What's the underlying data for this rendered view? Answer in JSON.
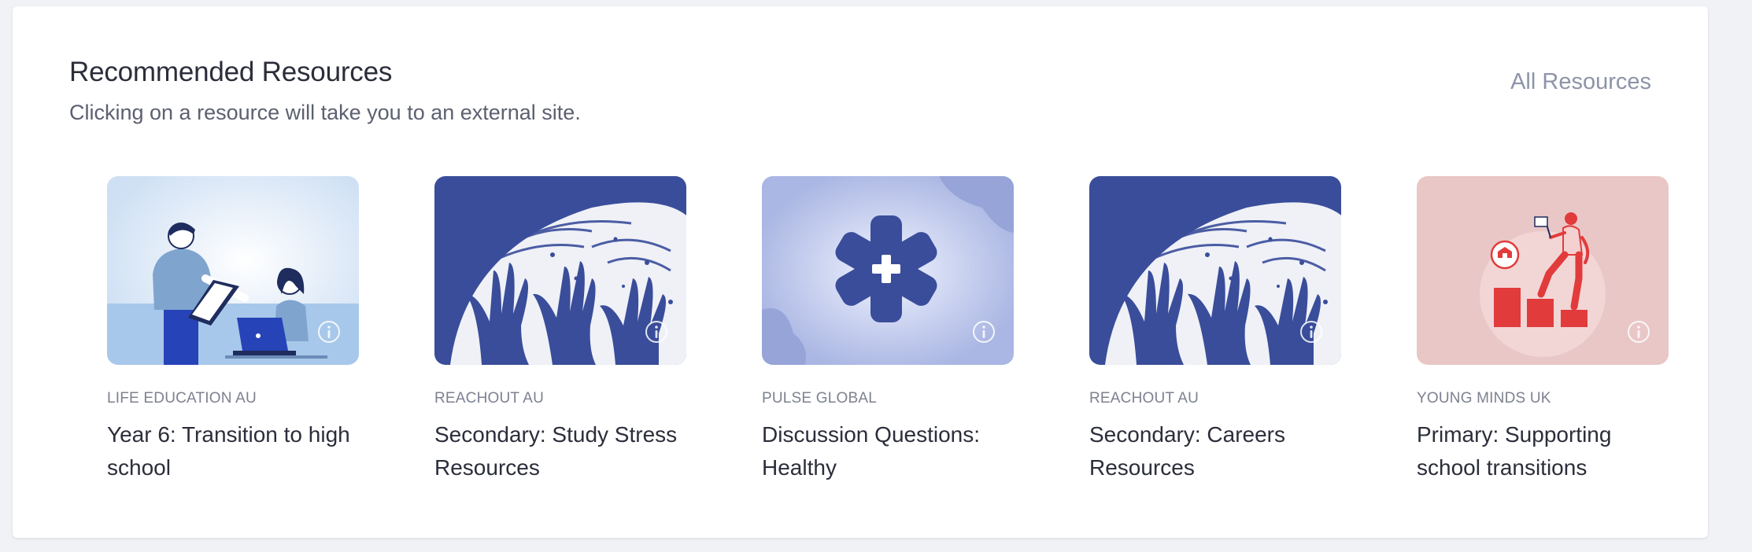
{
  "header": {
    "title": "Recommended Resources",
    "subtitle": "Clicking on a resource will take you to an external site.",
    "all_link": "All Resources"
  },
  "theme": {
    "navy": "#3a4d9a",
    "light_blue": "#cfe0f4",
    "periwinkle": "#aab6e3",
    "pink": "#e9c7c7",
    "red": "#e23b3b"
  },
  "cards": [
    {
      "source": "LIFE EDUCATION AU",
      "title": "Year 6: Transition to high school",
      "image": "teacher-student-illustration",
      "icon": "info-icon"
    },
    {
      "source": "REACHOUT AU",
      "title": "Secondary: Study Stress Resources",
      "image": "raised-hands-illustration",
      "icon": "info-icon"
    },
    {
      "source": "PULSE GLOBAL",
      "title": "Discussion Questions: Healthy",
      "image": "medical-cross-illustration",
      "icon": "info-icon"
    },
    {
      "source": "REACHOUT AU",
      "title": "Secondary: Careers Resources",
      "image": "raised-hands-illustration",
      "icon": "info-icon"
    },
    {
      "source": "YOUNG MINDS UK",
      "title": "Primary: Supporting school transitions",
      "image": "climbing-steps-illustration",
      "icon": "info-icon"
    }
  ]
}
